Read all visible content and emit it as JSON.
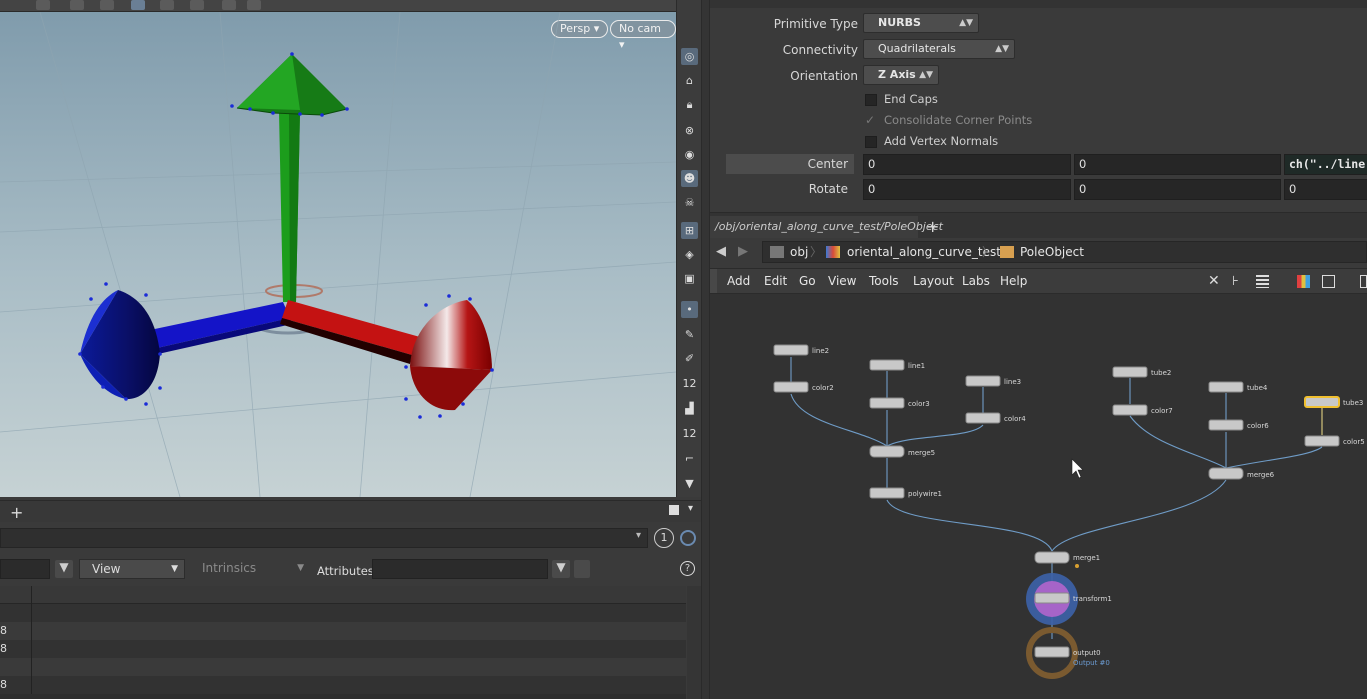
{
  "viewport": {
    "persp_label": "Persp",
    "cam_label": "No cam",
    "tool_icons": [
      "view-icon",
      "handle-icon",
      "lock-icon",
      "snap-icon",
      "visibility-icon",
      "ghost-icon",
      "skull-icon",
      "display-icon",
      "camera-icon",
      "render-icon",
      "point-icon",
      "brush-icon",
      "pen-icon",
      "guide-icon",
      "paint-icon",
      "bucket-icon",
      "guide2-icon",
      "chart-icon",
      "down-arrow-icon"
    ],
    "tool_labels": {
      "guide_a": "12",
      "guide_b": "12"
    }
  },
  "lower_panel": {
    "plus": "+",
    "circle_label": "1",
    "view_label": "View",
    "intrinsics_label": "Intrinsics",
    "attributes_label": "Attributes:",
    "rows": [
      "",
      "8",
      "8",
      "",
      "8",
      ""
    ]
  },
  "params": {
    "primitive_type": {
      "label": "Primitive Type",
      "value": "NURBS"
    },
    "connectivity": {
      "label": "Connectivity",
      "value": "Quadrilaterals"
    },
    "orientation": {
      "label": "Orientation",
      "value": "Z Axis"
    },
    "end_caps": "End Caps",
    "consolidate": "Consolidate Corner Points",
    "vertex_normals": "Add Vertex Normals",
    "center": {
      "label": "Center",
      "x": "0",
      "y": "0",
      "z": "ch(\"../line"
    },
    "rotate": {
      "label": "Rotate",
      "x": "0",
      "y": "0",
      "z": "0"
    }
  },
  "network": {
    "tab_label": "/obj/oriental_along_curve_test/PoleObject",
    "tab_close": "×",
    "tab_plus": "+",
    "crumbs": [
      "obj",
      "oriental_along_curve_test",
      "PoleObject"
    ],
    "menus": [
      "Add",
      "Edit",
      "Go",
      "View",
      "Tools",
      "Layout",
      "Labs",
      "Help"
    ],
    "nodes": {
      "line2": "line2",
      "color2": "color2",
      "line1": "line1",
      "color3": "color3",
      "line3": "line3",
      "color4": "color4",
      "merge5": "merge5",
      "polywire1": "polywire1",
      "tube2": "tube2",
      "color7": "color7",
      "tube4": "tube4",
      "color6": "color6",
      "tube3": "tube3",
      "color5": "color5",
      "merge6": "merge6",
      "merge1": "merge1",
      "transform1": "transform1",
      "output0": "output0",
      "output_sub": "Output #0"
    }
  }
}
